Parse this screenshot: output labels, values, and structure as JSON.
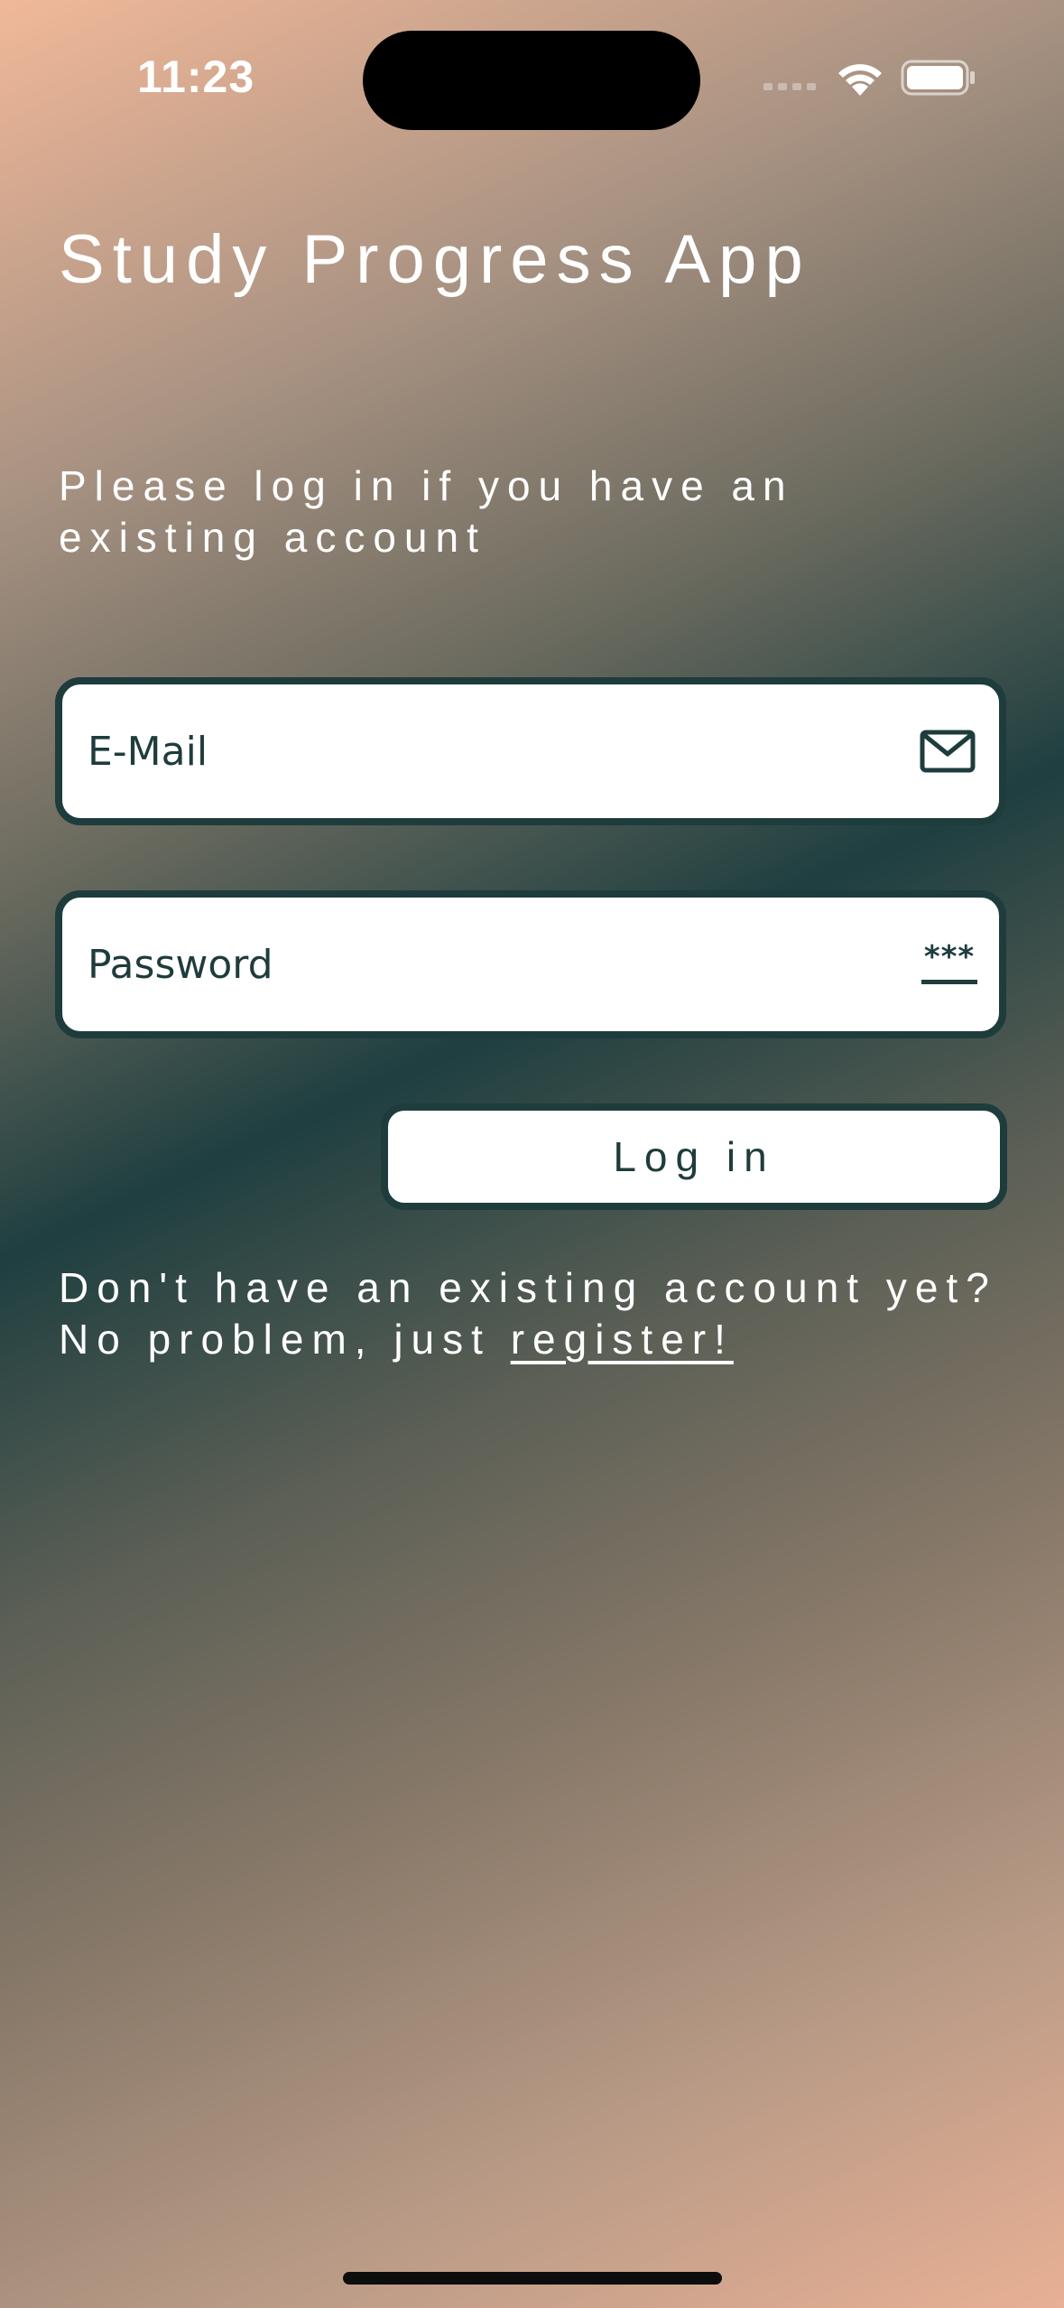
{
  "status_bar": {
    "time": "11:23",
    "icons": [
      "cell-signal-icon",
      "wifi-icon",
      "battery-icon"
    ]
  },
  "app": {
    "title": "Study Progress App",
    "login_prompt": "Please log in if you have an existing account"
  },
  "form": {
    "email": {
      "placeholder": "E-Mail",
      "value": "",
      "icon": "mail-icon"
    },
    "password": {
      "placeholder": "Password",
      "value": "",
      "icon": "password-icon",
      "icon_glyph": "***"
    },
    "login_label": "Log in"
  },
  "register": {
    "prefix": "Don't have an existing account yet? No problem, just ",
    "link_label": "register!"
  },
  "colors": {
    "accent": "#1f3c3d",
    "text_on_bg": "#ffffff",
    "field_bg": "#ffffff"
  }
}
